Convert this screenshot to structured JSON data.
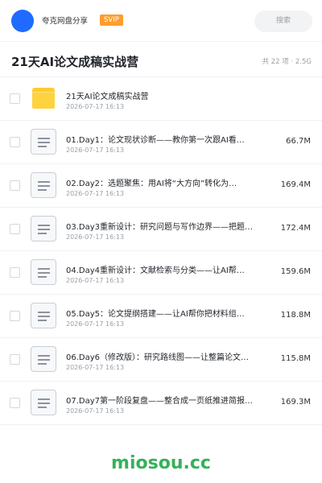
{
  "header": {
    "share_name": "夸克网盘分享",
    "badge": "SVIP",
    "search_label": "搜索"
  },
  "folder": {
    "title": "21天AI论文成稿实战营",
    "meta": "共 22 项 · 2.5G"
  },
  "items": [
    {
      "type": "folder",
      "name": "21天AI论文成稿实战营",
      "date": "2026-07-17 16:13",
      "size": ""
    },
    {
      "type": "file",
      "name": "01.Day1：论文现状诊断——教你第一次跟AI看…",
      "date": "2026-07-17 16:13",
      "size": "66.7M"
    },
    {
      "type": "file",
      "name": "02.Day2：选题聚焦：用AI将“大方向”转化为…",
      "date": "2026-07-17 16:13",
      "size": "169.4M"
    },
    {
      "type": "file",
      "name": "03.Day3重新设计：研究问题与写作边界——把题…",
      "date": "2026-07-17 16:13",
      "size": "172.4M"
    },
    {
      "type": "file",
      "name": "04.Day4重新设计：文献检索与分类——让AI帮…",
      "date": "2026-07-17 16:13",
      "size": "159.6M"
    },
    {
      "type": "file",
      "name": "05.Day5：论文提纲搭建——让AI帮你把材料组…",
      "date": "2026-07-17 16:13",
      "size": "118.8M"
    },
    {
      "type": "file",
      "name": "06.Day6（修改版）：研究路线图——让整篇论文…",
      "date": "2026-07-17 16:13",
      "size": "115.8M"
    },
    {
      "type": "file",
      "name": "07.Day7第一阶段复盘——整合成一页纸推进简报…",
      "date": "2026-07-17 16:13",
      "size": "169.3M"
    }
  ],
  "watermark": "miosou.cc",
  "colors": {
    "avatar": "#1f6bff",
    "svip": "#ff9d2e",
    "folder": "#ffd23f",
    "watermark": "#35b15a"
  }
}
